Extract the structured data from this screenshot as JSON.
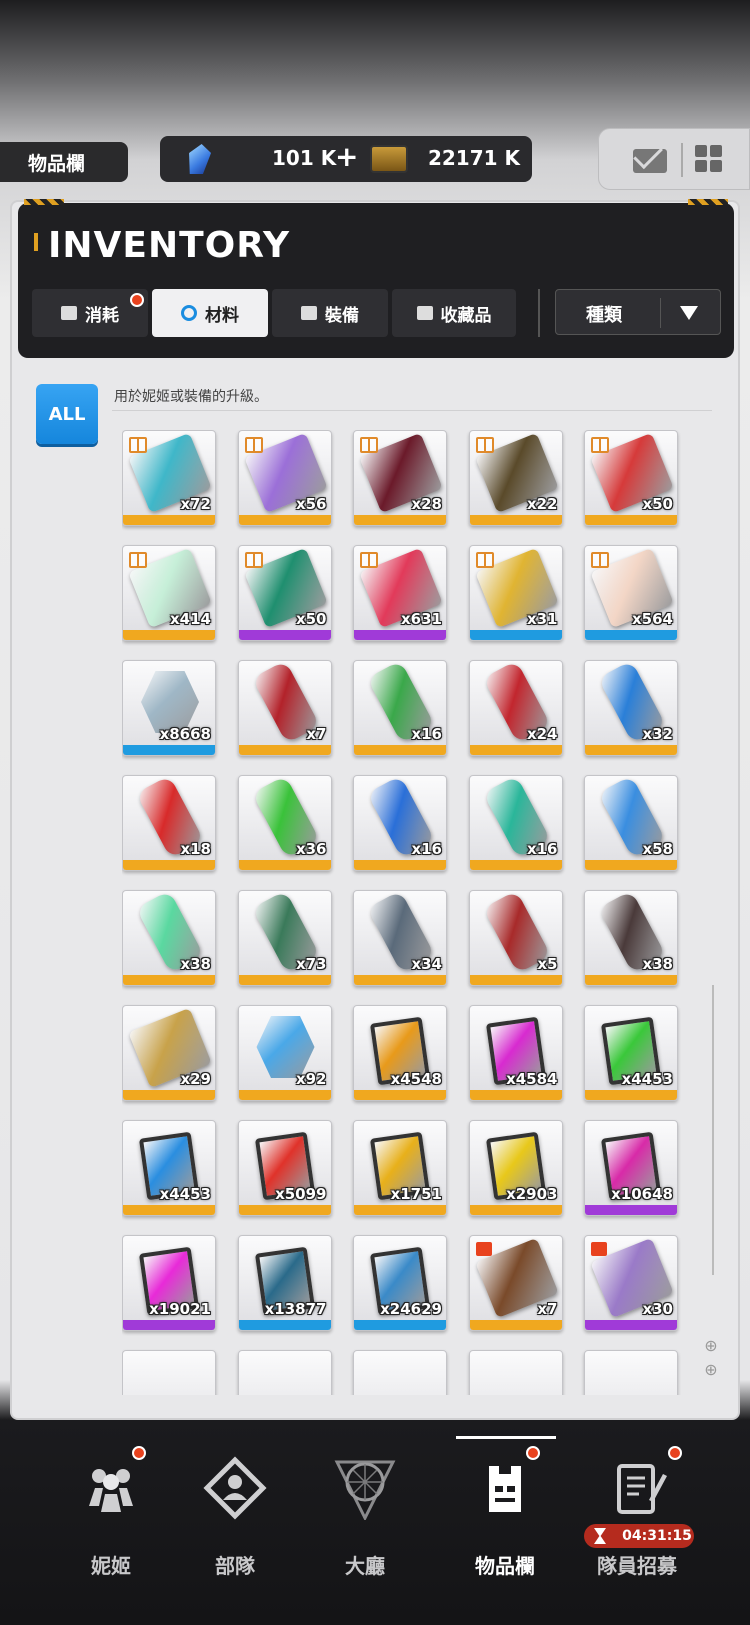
{
  "header": {
    "section_title": "物品欄",
    "gem_amount": "101 K",
    "plus_label": "+",
    "ticket_amount": "22171 K",
    "mail_icon": "mail-icon",
    "menu_icon": "grid-menu-icon"
  },
  "inventory": {
    "title": "INVENTORY",
    "tabs": [
      {
        "label": "消耗",
        "icon": "consumable-icon",
        "active": false,
        "badge": true
      },
      {
        "label": "材料",
        "icon": "material-icon",
        "active": true,
        "badge": false
      },
      {
        "label": "裝備",
        "icon": "equipment-icon",
        "active": false,
        "badge": false
      },
      {
        "label": "收藏品",
        "icon": "collection-icon",
        "active": false,
        "badge": false
      }
    ],
    "sort_label": "種類",
    "filter_all": "ALL",
    "description": "用於妮姬或裝備的升級。"
  },
  "items": [
    {
      "qty": "x72",
      "rarity": "#f0a81f",
      "color": "#3fb7c9",
      "kind": "ticket",
      "gift": true
    },
    {
      "qty": "x56",
      "rarity": "#f0a81f",
      "color": "#9b6fd8",
      "kind": "ticket",
      "gift": true
    },
    {
      "qty": "x28",
      "rarity": "#f0a81f",
      "color": "#6b1a2a",
      "kind": "ticket",
      "gift": true
    },
    {
      "qty": "x22",
      "rarity": "#f0a81f",
      "color": "#5a4a2a",
      "kind": "ticket",
      "gift": true
    },
    {
      "qty": "x50",
      "rarity": "#f0a81f",
      "color": "#d63a3a",
      "kind": "ticket",
      "gift": true
    },
    {
      "qty": "x414",
      "rarity": "#f0a81f",
      "color": "#c6efd8",
      "kind": "ticket",
      "gift": true
    },
    {
      "qty": "x50",
      "rarity": "#a03ad8",
      "color": "#1f8f6f",
      "kind": "ticket",
      "gift": true
    },
    {
      "qty": "x631",
      "rarity": "#a03ad8",
      "color": "#e23a5a",
      "kind": "ticket",
      "gift": true
    },
    {
      "qty": "x31",
      "rarity": "#1f9be0",
      "color": "#e0b432",
      "kind": "ticket",
      "gift": true
    },
    {
      "qty": "x564",
      "rarity": "#1f9be0",
      "color": "#f3d6c6",
      "kind": "ticket",
      "gift": true
    },
    {
      "qty": "x8668",
      "rarity": "#1f9be0",
      "color": "#9fb7c6",
      "kind": "hex",
      "gift": false
    },
    {
      "qty": "x7",
      "rarity": "#f0a81f",
      "color": "#b3222a",
      "kind": "canister",
      "gift": false
    },
    {
      "qty": "x16",
      "rarity": "#f0a81f",
      "color": "#3aa84a",
      "kind": "canister",
      "gift": false
    },
    {
      "qty": "x24",
      "rarity": "#f0a81f",
      "color": "#c2262e",
      "kind": "canister",
      "gift": false
    },
    {
      "qty": "x32",
      "rarity": "#f0a81f",
      "color": "#2a7fd8",
      "kind": "canister",
      "gift": false
    },
    {
      "qty": "x18",
      "rarity": "#f0a81f",
      "color": "#d82a2a",
      "kind": "canister",
      "gift": false
    },
    {
      "qty": "x36",
      "rarity": "#f0a81f",
      "color": "#3ac23a",
      "kind": "canister",
      "gift": false
    },
    {
      "qty": "x16",
      "rarity": "#f0a81f",
      "color": "#2a6fd8",
      "kind": "canister",
      "gift": false
    },
    {
      "qty": "x16",
      "rarity": "#f0a81f",
      "color": "#2ab69a",
      "kind": "canister",
      "gift": false
    },
    {
      "qty": "x58",
      "rarity": "#f0a81f",
      "color": "#3a8ee0",
      "kind": "canister",
      "gift": false
    },
    {
      "qty": "x38",
      "rarity": "#f0a81f",
      "color": "#5ad8a0",
      "kind": "canister",
      "gift": false
    },
    {
      "qty": "x73",
      "rarity": "#f0a81f",
      "color": "#3a7a5a",
      "kind": "canister",
      "gift": false
    },
    {
      "qty": "x34",
      "rarity": "#f0a81f",
      "color": "#5a6a7a",
      "kind": "canister",
      "gift": false
    },
    {
      "qty": "x5",
      "rarity": "#f0a81f",
      "color": "#a82a2a",
      "kind": "canister",
      "gift": false
    },
    {
      "qty": "x38",
      "rarity": "#f0a81f",
      "color": "#4a3a3a",
      "kind": "canister",
      "gift": false
    },
    {
      "qty": "x29",
      "rarity": "#f0a81f",
      "color": "#c8a24a",
      "kind": "ticket",
      "gift": false
    },
    {
      "qty": "x92",
      "rarity": "#f0a81f",
      "color": "#4aa8e8",
      "kind": "hex",
      "gift": false
    },
    {
      "qty": "x4548",
      "rarity": "#f0a81f",
      "color": "#e89a1a",
      "kind": "card",
      "gift": false
    },
    {
      "qty": "x4584",
      "rarity": "#f0a81f",
      "color": "#d82ad0",
      "kind": "card",
      "gift": false
    },
    {
      "qty": "x4453",
      "rarity": "#f0a81f",
      "color": "#3ac83a",
      "kind": "card",
      "gift": false
    },
    {
      "qty": "x4453",
      "rarity": "#f0a81f",
      "color": "#2a8ee0",
      "kind": "card",
      "gift": false
    },
    {
      "qty": "x5099",
      "rarity": "#f0a81f",
      "color": "#e0322a",
      "kind": "card",
      "gift": false
    },
    {
      "qty": "x1751",
      "rarity": "#f0a81f",
      "color": "#e8b01a",
      "kind": "card",
      "gift": false
    },
    {
      "qty": "x2903",
      "rarity": "#f0a81f",
      "color": "#e8c81a",
      "kind": "card",
      "gift": false
    },
    {
      "qty": "x10648",
      "rarity": "#a03ad8",
      "color": "#d82aa8",
      "kind": "card",
      "gift": false
    },
    {
      "qty": "x19021",
      "rarity": "#a03ad8",
      "color": "#e82ad8",
      "kind": "card",
      "gift": false
    },
    {
      "qty": "x13877",
      "rarity": "#1f9be0",
      "color": "#2a6a8a",
      "kind": "card",
      "gift": false
    },
    {
      "qty": "x24629",
      "rarity": "#1f9be0",
      "color": "#3a8ac8",
      "kind": "card",
      "gift": false
    },
    {
      "qty": "x7",
      "rarity": "#f0a81f",
      "color": "#7a4a2a",
      "kind": "box",
      "gift": false
    },
    {
      "qty": "x30",
      "rarity": "#a03ad8",
      "color": "#9a7ac8",
      "kind": "box",
      "gift": false
    }
  ],
  "nav": {
    "items": [
      {
        "label": "妮姬",
        "icon": "nikke-icon",
        "active": false,
        "badge": true
      },
      {
        "label": "部隊",
        "icon": "squad-icon",
        "active": false,
        "badge": false
      },
      {
        "label": "大廳",
        "icon": "lobby-icon",
        "active": false,
        "badge": false
      },
      {
        "label": "物品欄",
        "icon": "inventory-icon",
        "active": true,
        "badge": true
      },
      {
        "label": "隊員招募",
        "icon": "recruit-icon",
        "active": false,
        "badge": true
      }
    ],
    "recruit_timer": "04:31:15"
  }
}
